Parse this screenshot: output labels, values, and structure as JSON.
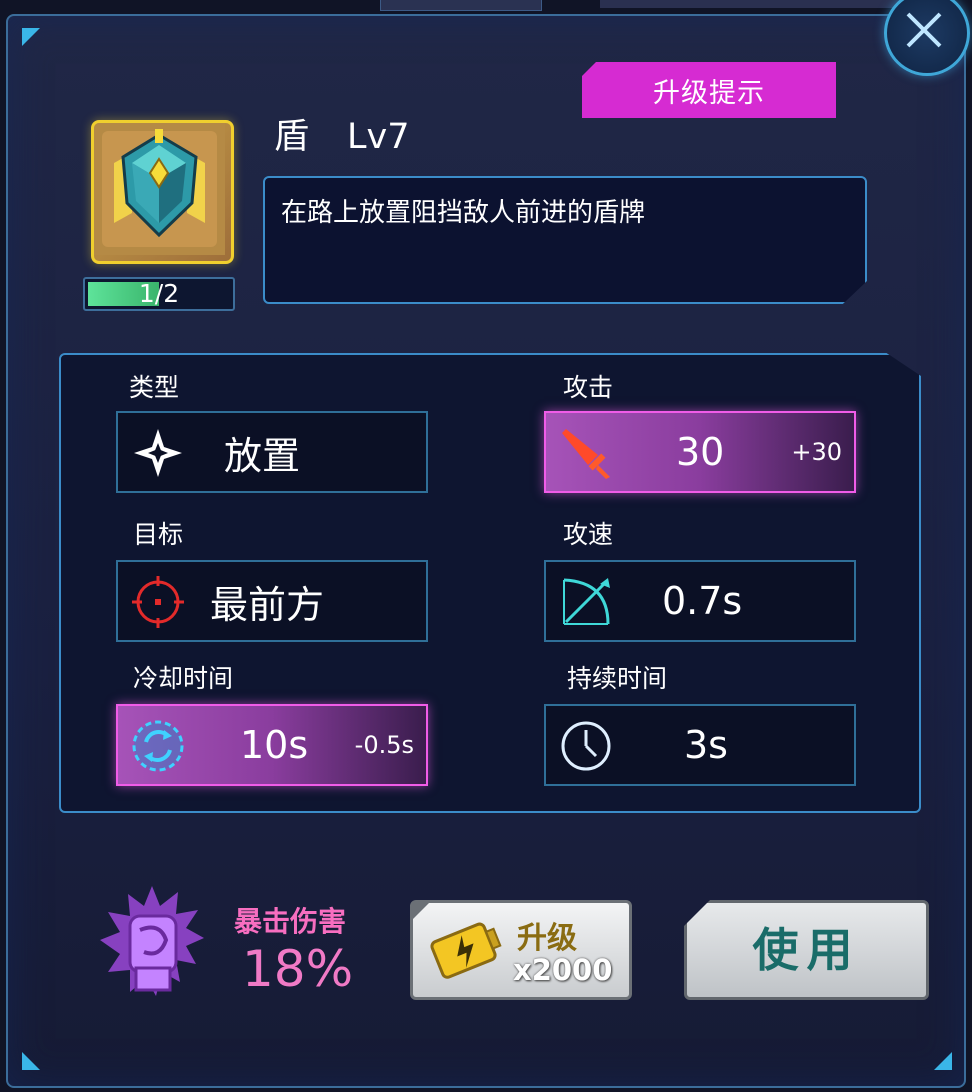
{
  "skill": {
    "name": "盾",
    "level": "Lv7",
    "description": "在路上放置阻挡敌人前进的盾牌",
    "progress_text": "1/2",
    "progress": 0.5
  },
  "upgrade_tip_label": "升级提示",
  "stats": {
    "type": {
      "label": "类型",
      "value": "放置",
      "icon": "diamond-sparkle-icon"
    },
    "target": {
      "label": "目标",
      "value": "最前方",
      "icon": "crosshair-icon"
    },
    "cooldown": {
      "label": "冷却时间",
      "value": "10s",
      "bonus": "-0.5s",
      "icon": "cooldown-cycle-icon"
    },
    "attack": {
      "label": "攻击",
      "value": "30",
      "bonus": "+30",
      "icon": "sword-icon"
    },
    "attack_speed": {
      "label": "攻速",
      "value": "0.7s",
      "icon": "bow-icon"
    },
    "duration": {
      "label": "持续时间",
      "value": "3s",
      "icon": "clock-icon"
    }
  },
  "crit": {
    "label": "暴击伤害",
    "value": "18%",
    "icon": "crit-fist-icon"
  },
  "buttons": {
    "upgrade_label": "升级",
    "upgrade_cost": "x2000",
    "use_label": "使用"
  },
  "colors": {
    "accent_pink": "#d62bd2",
    "border_blue": "#3b8cc9",
    "highlight_magenta": "#f05ce8",
    "crit_pink": "#f76ec0"
  }
}
